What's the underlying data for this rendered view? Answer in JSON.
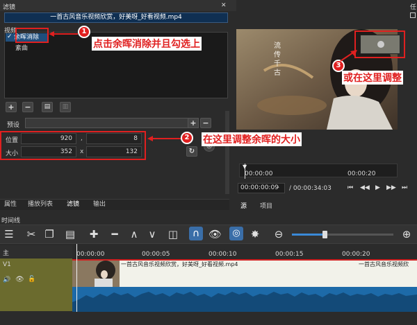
{
  "filters_panel": {
    "title": "滤镜",
    "clip_name": "一首古风音乐视频欣赏，好美呀_好看视频.mp4",
    "category": "视频",
    "items": [
      {
        "label": "余晖消除",
        "checked": true,
        "selected": true
      },
      {
        "label": "紊曲",
        "checked": false,
        "selected": false
      }
    ],
    "preset_label": "预设",
    "position_label": "位置",
    "position_x": "920",
    "position_sep": ",",
    "position_y": "8",
    "size_label": "大小",
    "size_w": "352",
    "size_sep": "x",
    "size_h": "132"
  },
  "bottom_tabs": [
    "属性",
    "播放列表",
    "滤镜",
    "输出"
  ],
  "player": {
    "video_vertical_text": "流传千古",
    "ruler": {
      "start": "00:00:00",
      "mid": "00:00:20"
    },
    "timecode_current": "00:00:00:09",
    "timecode_total": "/ 00:00:34:03",
    "tabs": [
      "源",
      "项目"
    ],
    "right_panel_label": "任"
  },
  "timeline": {
    "title": "时间线",
    "main_track": "主",
    "v1_track": "V1",
    "ruler_ticks": [
      "00:00:00",
      "00:00:05",
      "00:00:10",
      "00:00:15",
      "00:00:20"
    ],
    "clip_label_1": "一首古风音乐视频欣赏，好美呀_好看视频.mp4",
    "clip_label_2": "一首古风音乐视频欣"
  },
  "annotations": {
    "a1_num": "1",
    "a1_text": "点击余晖消除并且勾选上",
    "a2_num": "2",
    "a2_text": "在这里调整余晖的大小",
    "a3_num": "3",
    "a3_text": "或在这里调整"
  },
  "colors": {
    "accent_red": "#e02020",
    "audio_blue": "#1d6aa8",
    "track_olive": "#6b6b2e"
  }
}
